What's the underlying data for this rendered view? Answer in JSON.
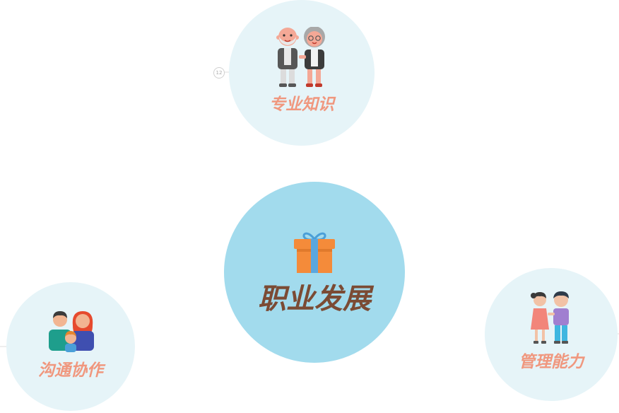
{
  "center": {
    "title": "职业发展",
    "icon": "gift-icon"
  },
  "nodes": [
    {
      "label": "专业知识",
      "icon": "elderly-couple-icon",
      "badge": "12"
    },
    {
      "label": "沟通协作",
      "icon": "family-icon"
    },
    {
      "label": "管理能力",
      "icon": "young-couple-icon"
    }
  ],
  "colors": {
    "center_fill": "#a2dbed",
    "satellite_fill": "#e6f4f8",
    "satellite_label": "#f0977e",
    "center_label": "#7b4b34"
  }
}
